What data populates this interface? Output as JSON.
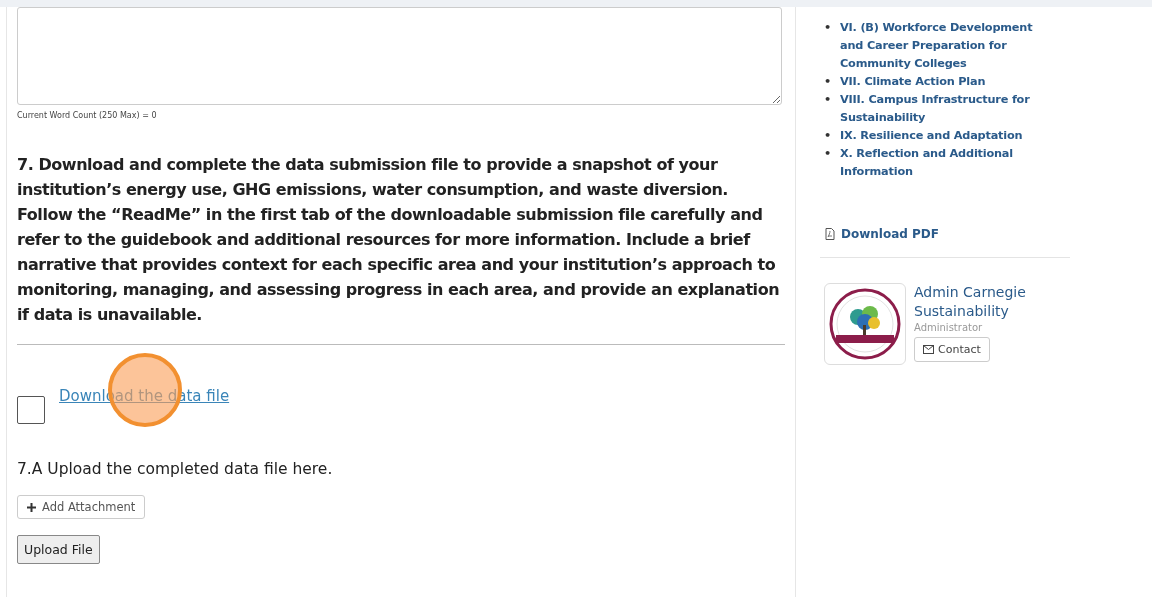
{
  "form": {
    "word_count": "Current Word Count (250 Max) = 0",
    "question": "7. Download and complete the data submission file to provide a snapshot of your institution’s energy use, GHG emissions, water consumption, and waste diversion. Follow the “ReadMe” in the first tab of the downloadable submission file carefully and refer to the guidebook and additional resources for more information. Include a brief narrative that provides context for each specific area and your institution’s approach to monitoring, managing, and assessing progress in each area, and provide an explanation if data is unavailable.",
    "download_task": {
      "checked": false,
      "link": "Download the data file"
    },
    "upload_label": "7.A Upload the completed data file here.",
    "add_attachment": "Add Attachment",
    "upload_button": "Upload File"
  },
  "sidebar": {
    "sections": [
      {
        "bullet": "•",
        "label": "VI. (B) Workforce Development and Career Preparation for Community Colleges"
      },
      {
        "bullet": "•",
        "label": "VII. Climate Action Plan"
      },
      {
        "bullet": "•",
        "label": "VIII. Campus Infrastructure for Sustainability"
      },
      {
        "bullet": "•",
        "label": "IX. Resilience and Adaptation"
      },
      {
        "bullet": "•",
        "label": "X. Reflection and Additional Information"
      }
    ],
    "download_pdf": "Download PDF",
    "profile": {
      "name": "Admin Carnegie Sustainability",
      "role": "Administrator",
      "contact": "Contact"
    }
  }
}
